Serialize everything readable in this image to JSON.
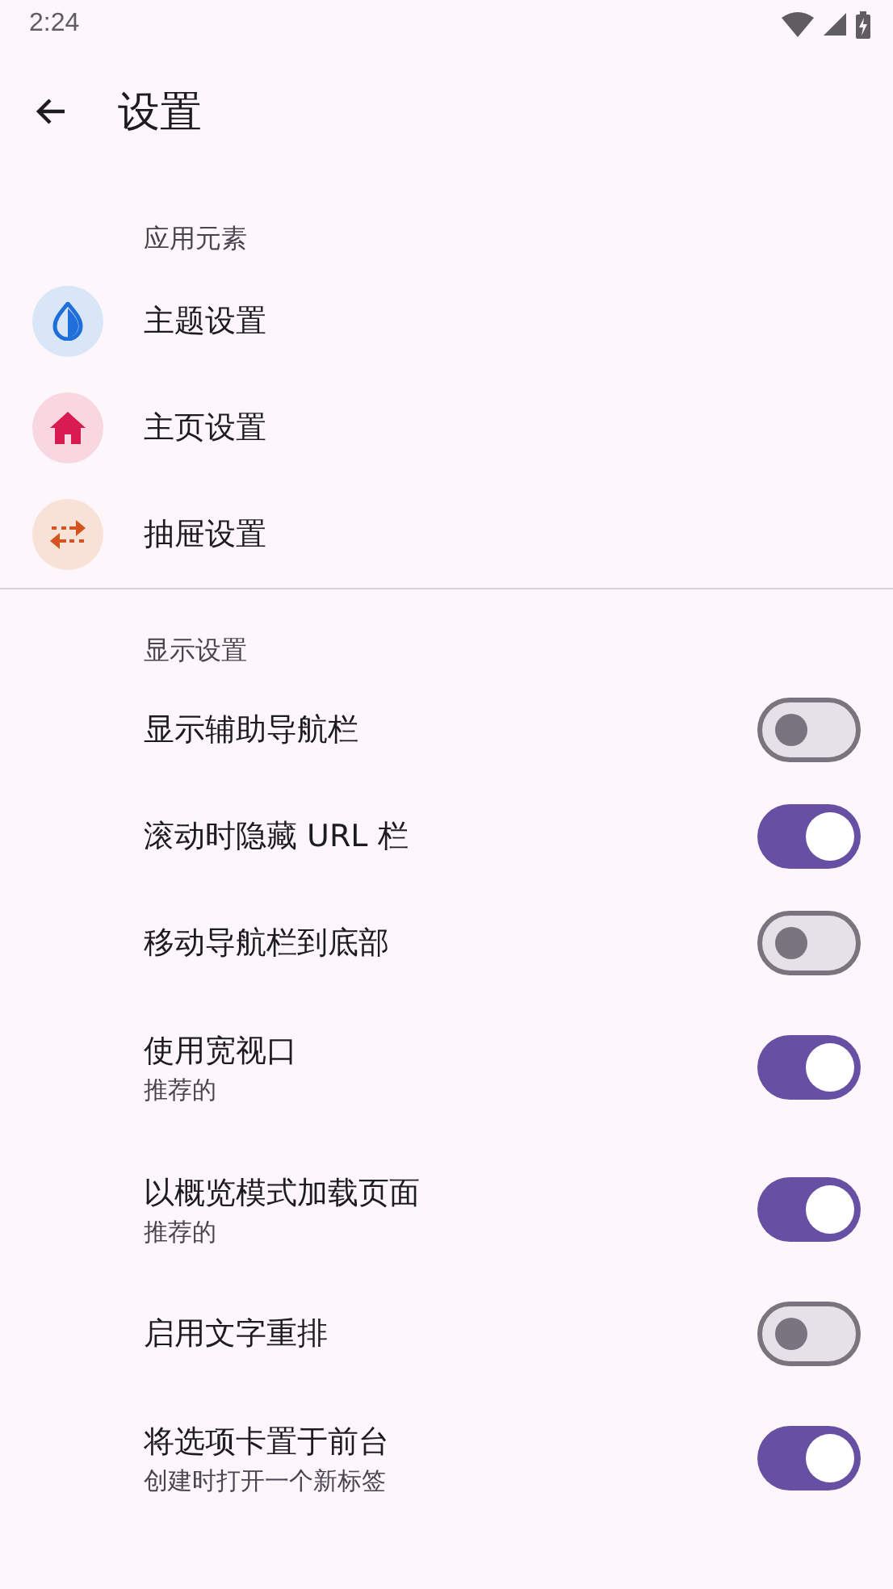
{
  "status_bar": {
    "time": "2:24"
  },
  "header": {
    "title": "设置"
  },
  "sections": [
    {
      "title": "应用元素",
      "items": [
        {
          "kind": "link",
          "label": "主题设置"
        },
        {
          "kind": "link",
          "label": "主页设置"
        },
        {
          "kind": "link",
          "label": "抽屉设置"
        }
      ]
    },
    {
      "title": "显示设置",
      "items": [
        {
          "kind": "toggle",
          "label": "显示辅助导航栏",
          "on": false
        },
        {
          "kind": "toggle",
          "label": "滚动时隐藏 URL 栏",
          "on": true
        },
        {
          "kind": "toggle",
          "label": "移动导航栏到底部",
          "on": false
        },
        {
          "kind": "toggle",
          "label": "使用宽视口",
          "summary": "推荐的",
          "on": true
        },
        {
          "kind": "toggle",
          "label": "以概览模式加载页面",
          "summary": "推荐的",
          "on": true
        },
        {
          "kind": "toggle",
          "label": "启用文字重排",
          "on": false
        },
        {
          "kind": "toggle",
          "label": "将选项卡置于前台",
          "summary": "创建时打开一个新标签",
          "on": true
        }
      ]
    }
  ]
}
